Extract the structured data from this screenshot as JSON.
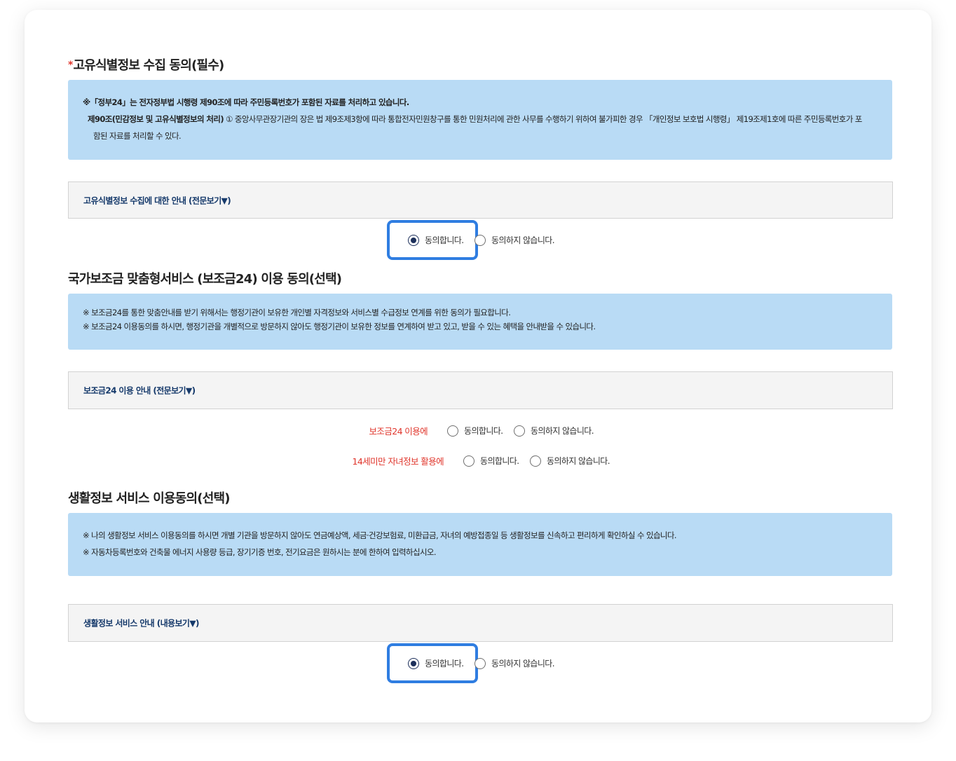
{
  "section1": {
    "required_mark": "*",
    "title": "고유식별정보 수집 동의(필수)",
    "notice_line1": "※「정부24」는 전자정부법 시행령 제90조에 따라 주민등록번호가 포함된 자료를 처리하고 있습니다.",
    "notice_line2_bold": "제90조(민감정보 및 고유식별정보의 처리)",
    "notice_line2_rest": " ① 중앙사무관장기관의 장은 법 제9조제3항에 따라 통합전자민원창구를 통한 민원처리에 관한 사무를 수행하기 위하여 불가피한 경우 「개인정보 보호법 시행령」 제19조제1호에 따른 주민등록번호가 포",
    "notice_line3": "함된 자료를 처리할 수 있다.",
    "guide_label": "고유식별정보 수집에 대한 안내 (전문보기▼)",
    "agree_label": "동의합니다.",
    "disagree_label": "동의하지 않습니다."
  },
  "section2": {
    "title": "국가보조금 맞춤형서비스 (보조금24) 이용 동의(선택)",
    "notice_line1": "※ 보조금24를 통한 맞춤안내를 받기 위해서는 행정기관이 보유한 개인별 자격정보와 서비스별 수급정보 연계를 위한 동의가 필요합니다.",
    "notice_line2": "※ 보조금24 이용동의를 하시면, 행정기관을 개별적으로 방문하지 않아도 행정기관이 보유한 정보를 연계하여 받고 있고, 받을 수 있는 혜택을 안내받을 수 있습니다.",
    "guide_label": "보조금24 이용 안내 (전문보기▼)",
    "row1_label": "보조금24 이용에",
    "row2_label": "14세미만 자녀정보 활용에",
    "agree_label": "동의합니다.",
    "disagree_label": "동의하지 않습니다."
  },
  "section3": {
    "title": "생활정보 서비스 이용동의(선택)",
    "notice_line1": "※ 나의 생활정보 서비스 이용동의를 하시면 개별 기관을 방문하지 않아도 연금예상액, 세금·건강보험료, 미환급금, 자녀의 예방접종일 등 생활정보를 신속하고 편리하게 확인하실 수 있습니다.",
    "notice_line2": "※ 자동차등록번호와 건축물 에너지 사용량 등급, 장기기증 번호, 전기요금은 원하시는 분에 한하여 입력하십시오.",
    "guide_label": "생활정보 서비스 안내 (내용보기▼)",
    "agree_label": "동의합니다.",
    "disagree_label": "동의하지 않습니다."
  },
  "colors": {
    "notice_bg": "#b9dbf5",
    "highlight": "#2f7de1",
    "required": "#e0352b",
    "guide_text": "#163a6b"
  }
}
